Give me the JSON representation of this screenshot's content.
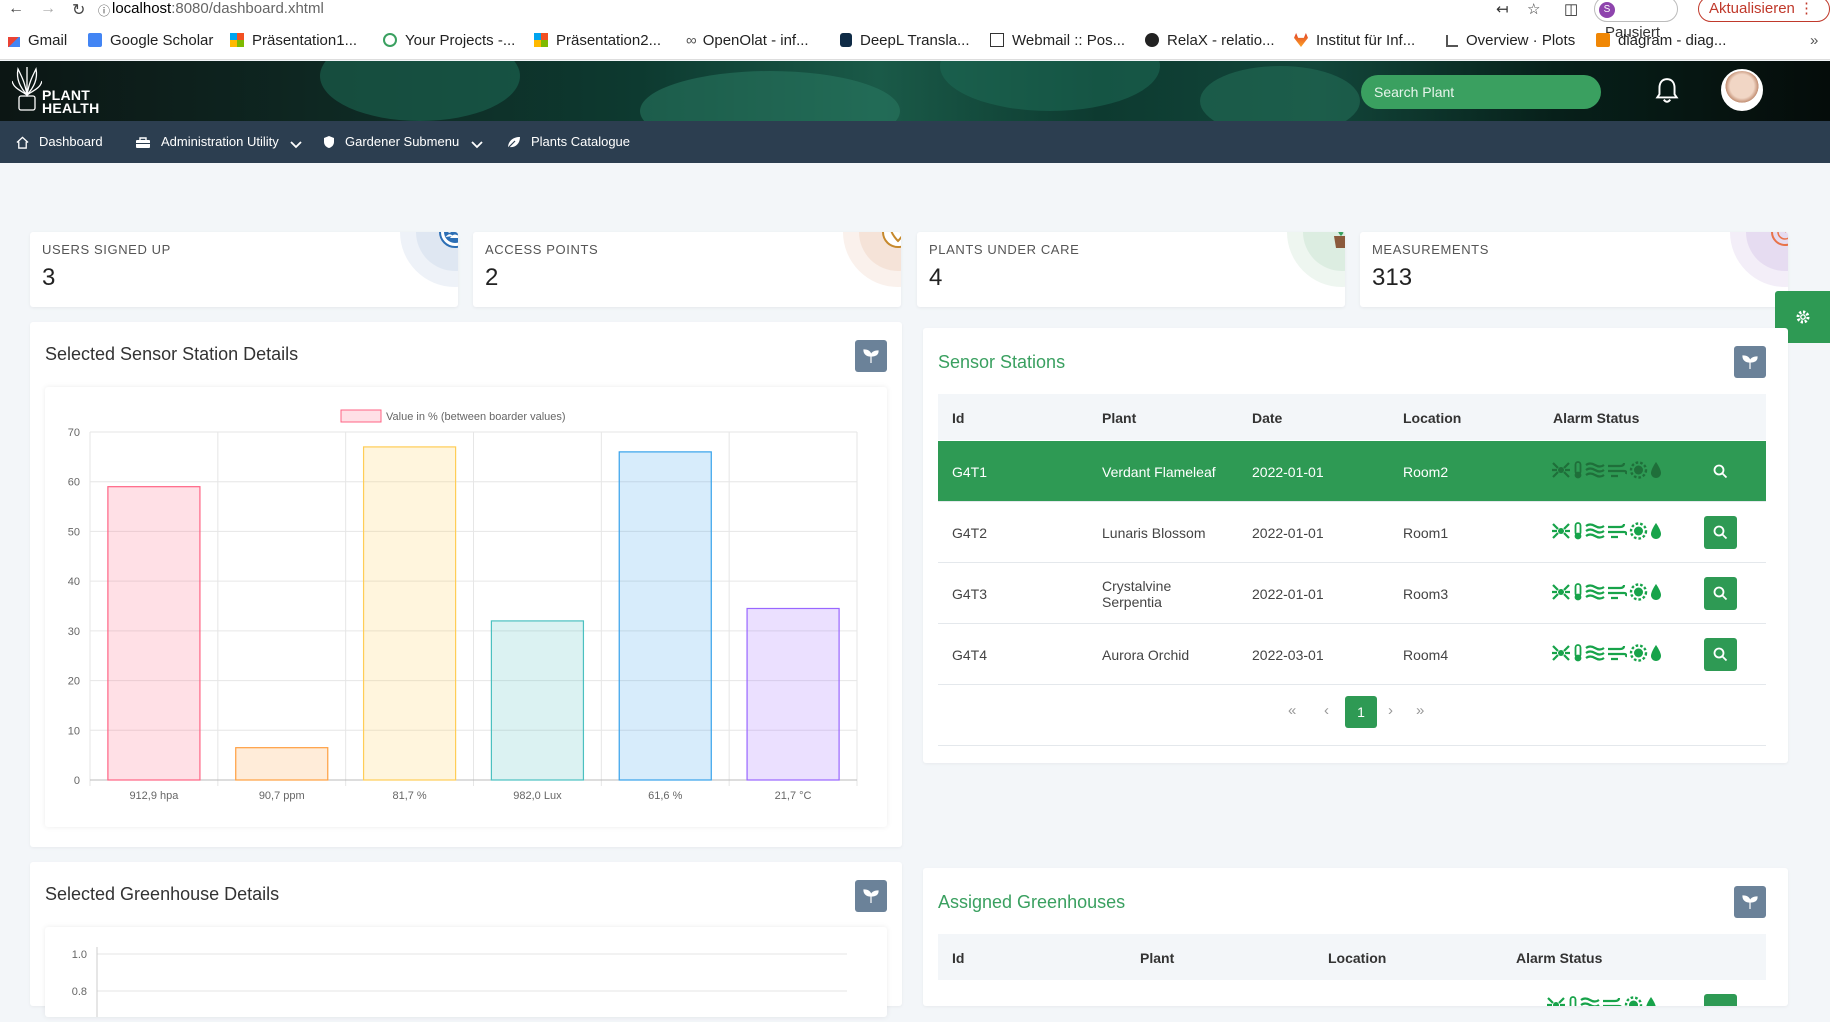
{
  "browser": {
    "url_host": "localhost",
    "url_path": ":8080/dashboard.xhtml",
    "profile_label": "Pausiert",
    "profile_initial": "S",
    "update_label": "Aktualisieren",
    "bookmarks": [
      "Gmail",
      "Google Scholar",
      "Präsentation1...",
      "Your Projects -...",
      "Präsentation2...",
      "OpenOlat - inf...",
      "DeepL Transla...",
      "Webmail :: Pos...",
      "RelaX - relatio...",
      "Institut für Inf...",
      "Overview · Plots",
      "diagram - diag..."
    ]
  },
  "header": {
    "logo_line1": "PLANT",
    "logo_line2": "HEALTH",
    "search_placeholder": "Search Plant"
  },
  "menu": {
    "dashboard": "Dashboard",
    "admin": "Administration Utility",
    "gardener": "Gardener Submenu",
    "catalogue": "Plants Catalogue"
  },
  "stats": [
    {
      "label": "USERS SIGNED UP",
      "value": "3",
      "color": "#2d6fb5"
    },
    {
      "label": "ACCESS POINTS",
      "value": "2",
      "color": "#c6892d"
    },
    {
      "label": "PLANTS UNDER CARE",
      "value": "4",
      "color": "#3aa060"
    },
    {
      "label": "MEASUREMENTS",
      "value": "313",
      "color": "#e8734a"
    }
  ],
  "sensor_details": {
    "title": "Selected Sensor Station Details",
    "chart_data": {
      "type": "bar",
      "legend": "Value in % (between boarder values)",
      "categories": [
        "912,9 hpa",
        "90,7 ppm",
        "81,7 %",
        "982,0 Lux",
        "61,6 %",
        "21,7 °C"
      ],
      "values": [
        59,
        6.5,
        67,
        32,
        66,
        34.5
      ],
      "ylim": [
        0,
        70
      ],
      "yticks": [
        0,
        10,
        20,
        30,
        40,
        50,
        60,
        70
      ],
      "colors": [
        "#ff6384",
        "#ff9f40",
        "#ffcd56",
        "#4bc0c0",
        "#36a2eb",
        "#9966ff"
      ]
    }
  },
  "sensor_stations": {
    "title": "Sensor Stations",
    "columns": [
      "Id",
      "Plant",
      "Date",
      "Location",
      "Alarm Status"
    ],
    "rows": [
      {
        "id": "G4T1",
        "plant": "Verdant Flameleaf",
        "date": "2022-01-01",
        "location": "Room2"
      },
      {
        "id": "G4T2",
        "plant": "Lunaris Blossom",
        "date": "2022-01-01",
        "location": "Room1"
      },
      {
        "id": "G4T3",
        "plant": "Crystalvine Serpentia",
        "date": "2022-01-01",
        "location": "Room3"
      },
      {
        "id": "G4T4",
        "plant": "Aurora Orchid",
        "date": "2022-03-01",
        "location": "Room4"
      }
    ],
    "page": "1",
    "pager": {
      "first": "«",
      "prev": "‹",
      "next": "›",
      "last": "»"
    }
  },
  "greenhouse_details": {
    "title": "Selected Greenhouse Details",
    "yticks": [
      "1.0",
      "0.8"
    ]
  },
  "assigned_greenhouses": {
    "title": "Assigned Greenhouses",
    "columns": [
      "Id",
      "Plant",
      "Location",
      "Alarm Status"
    ]
  }
}
